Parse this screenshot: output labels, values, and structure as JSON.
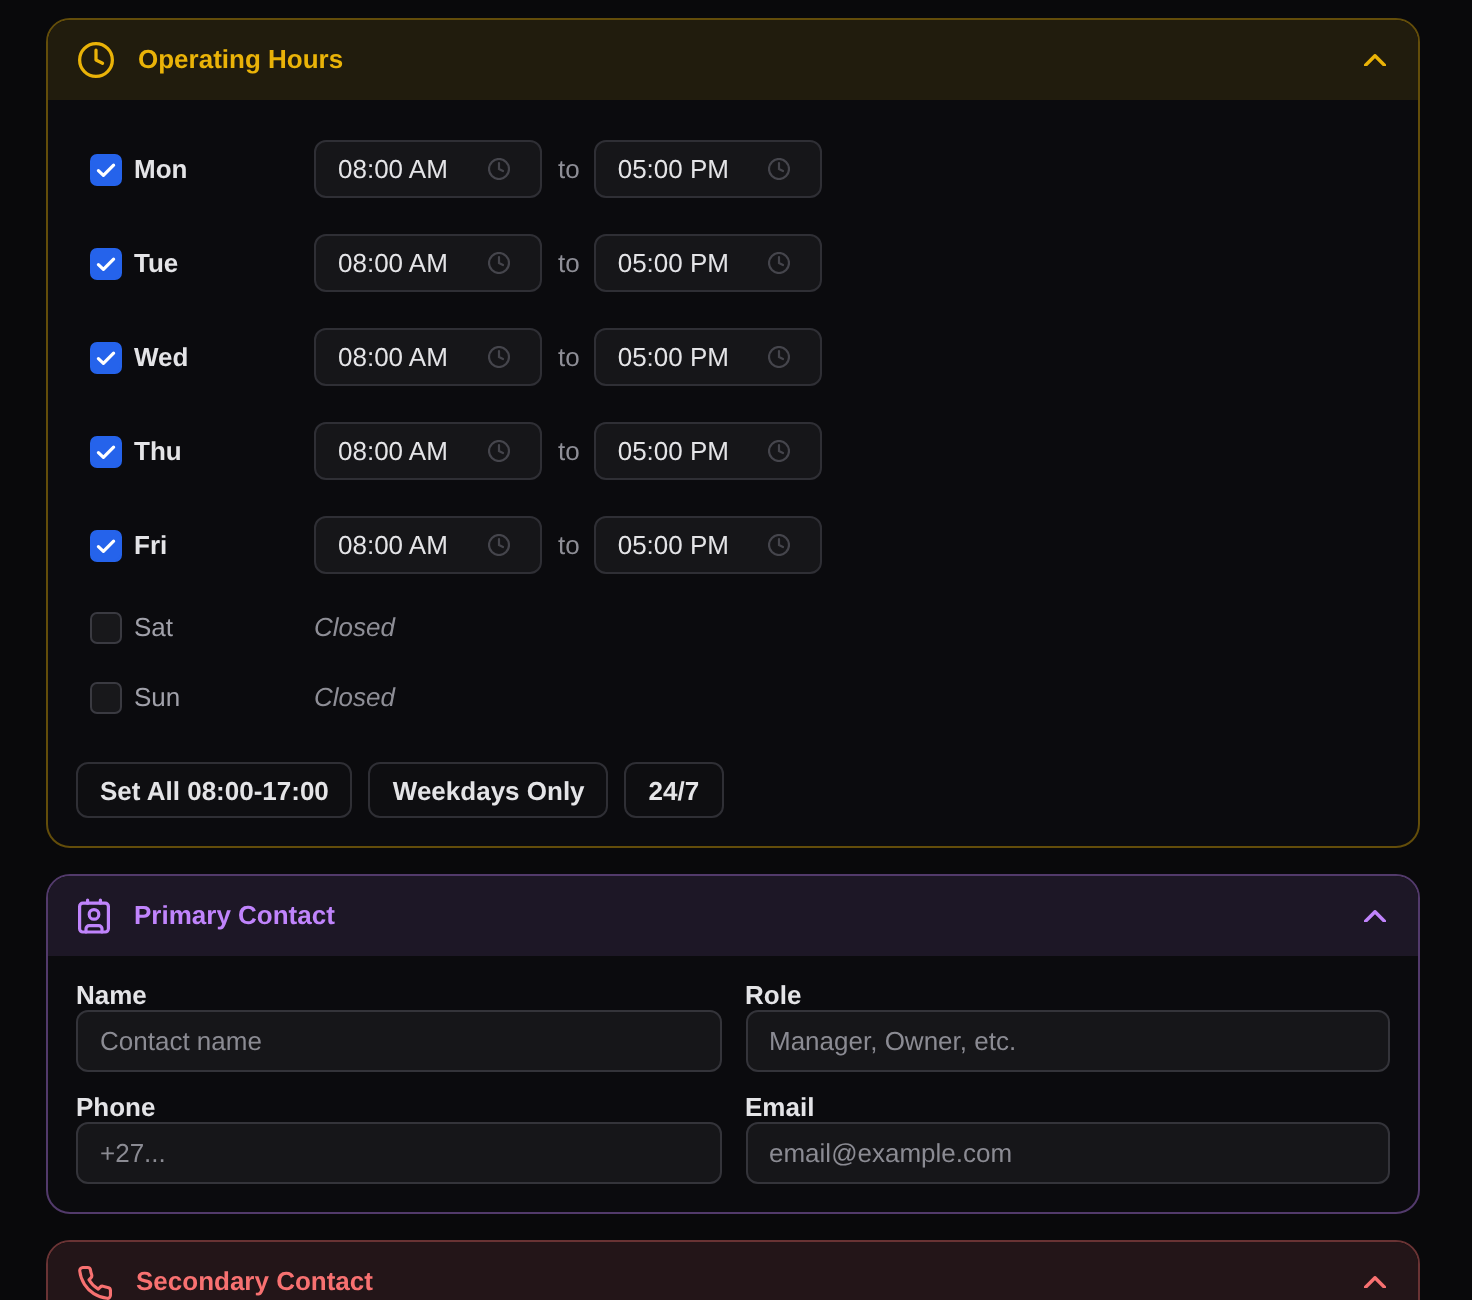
{
  "sections": [
    {
      "kind": "hours",
      "title": "Operating Hours",
      "color": "#eab308",
      "expanded": true,
      "days": [
        {
          "label": "Mon",
          "checked": true,
          "open": "08:00 AM",
          "separator": "to",
          "close": "05:00 PM"
        },
        {
          "label": "Tue",
          "checked": true,
          "open": "08:00 AM",
          "separator": "to",
          "close": "05:00 PM"
        },
        {
          "label": "Wed",
          "checked": true,
          "open": "08:00 AM",
          "separator": "to",
          "close": "05:00 PM"
        },
        {
          "label": "Thu",
          "checked": true,
          "open": "08:00 AM",
          "separator": "to",
          "close": "05:00 PM"
        },
        {
          "label": "Fri",
          "checked": true,
          "open": "08:00 AM",
          "separator": "to",
          "close": "05:00 PM"
        },
        {
          "label": "Sat",
          "checked": false,
          "status": "Closed"
        },
        {
          "label": "Sun",
          "checked": false,
          "status": "Closed"
        }
      ],
      "buttons": [
        "Set All 08:00-17:00",
        "Weekdays Only",
        "24/7"
      ]
    },
    {
      "kind": "primary_contact",
      "title": "Primary Contact",
      "color": "#c084fc",
      "expanded": true,
      "fields": [
        {
          "label": "Name",
          "placeholder": "Contact name"
        },
        {
          "label": "Role",
          "placeholder": "Manager, Owner, etc."
        },
        {
          "label": "Phone",
          "placeholder": "+27..."
        },
        {
          "label": "Email",
          "placeholder": "email@example.com"
        }
      ]
    },
    {
      "kind": "secondary_contact",
      "title": "Secondary Contact",
      "color": "#f87171",
      "expanded": true
    }
  ]
}
